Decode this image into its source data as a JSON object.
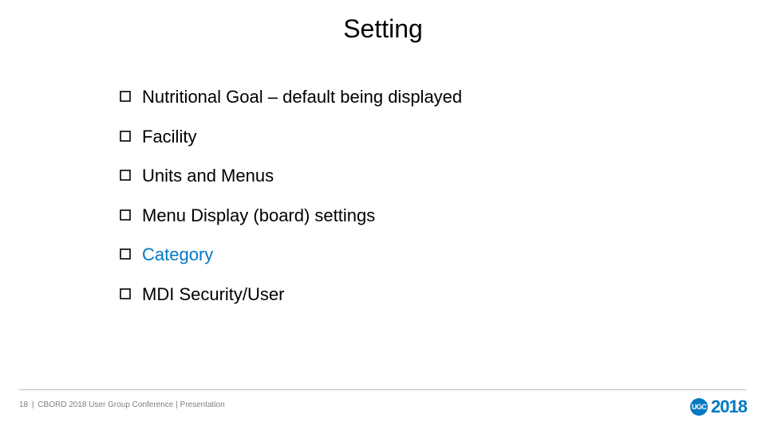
{
  "title": "Setting",
  "items": [
    {
      "text": "Nutritional Goal – default being displayed",
      "highlight": false
    },
    {
      "text": "Facility",
      "highlight": false
    },
    {
      "text": "Units and Menus",
      "highlight": false
    },
    {
      "text": "Menu Display (board) settings",
      "highlight": false
    },
    {
      "text": "Category",
      "highlight": true
    },
    {
      "text": "MDI Security/User",
      "highlight": false
    }
  ],
  "footer": {
    "page": "18",
    "text": "CBORD 2018 User Group Conference | Presentation"
  },
  "logo": {
    "badge": "UGC",
    "year": "2018"
  }
}
